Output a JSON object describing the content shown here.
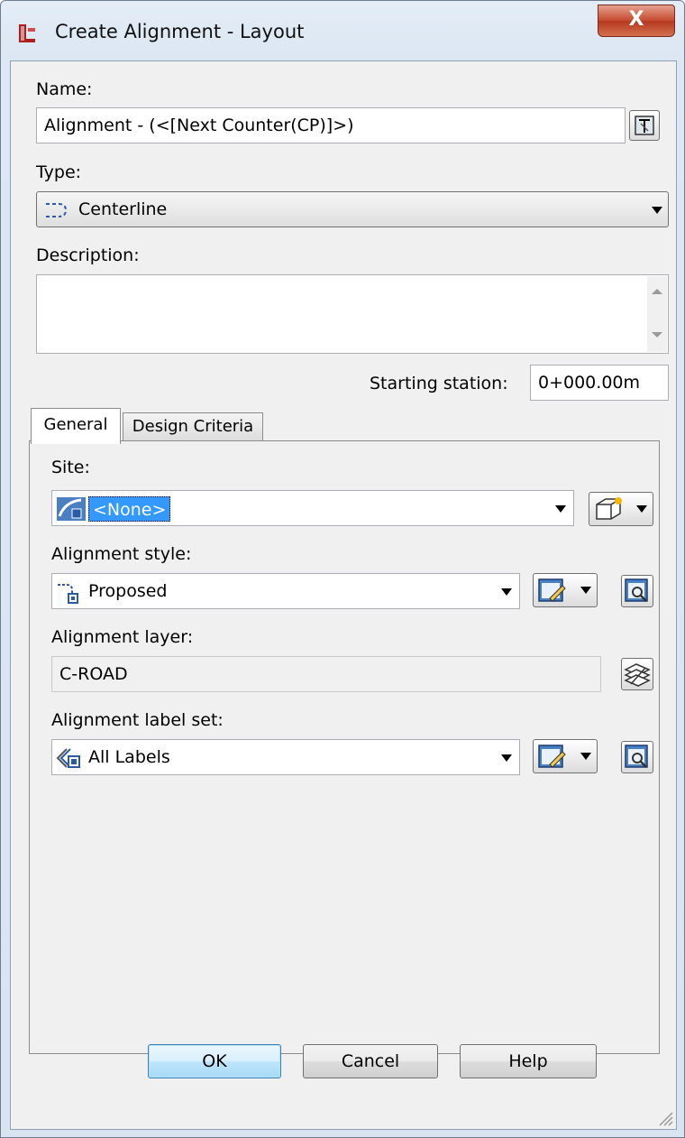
{
  "window": {
    "title": "Create Alignment - Layout",
    "close_glyph": "X"
  },
  "form": {
    "name_label": "Name:",
    "name_value": "Alignment - (<[Next Counter(CP)]>)",
    "type_label": "Type:",
    "type_value": "Centerline",
    "description_label": "Description:",
    "description_value": "",
    "starting_station_label": "Starting station:",
    "starting_station_value": "0+000.00m"
  },
  "tabs": [
    {
      "label": "General",
      "selected": true
    },
    {
      "label": "Design Criteria",
      "selected": false
    }
  ],
  "general": {
    "site_label": "Site:",
    "site_value": "<None>",
    "alignment_style_label": "Alignment style:",
    "alignment_style_value": "Proposed",
    "alignment_layer_label": "Alignment layer:",
    "alignment_layer_value": "C-ROAD",
    "alignment_label_set_label": "Alignment label set:",
    "alignment_label_set_value": "All Labels"
  },
  "buttons": {
    "ok": "OK",
    "cancel": "Cancel",
    "help": "Help"
  },
  "colors": {
    "selection_highlight": "#3399ff",
    "close_button": "#c7492f",
    "default_button_border": "#3c7fb1"
  }
}
